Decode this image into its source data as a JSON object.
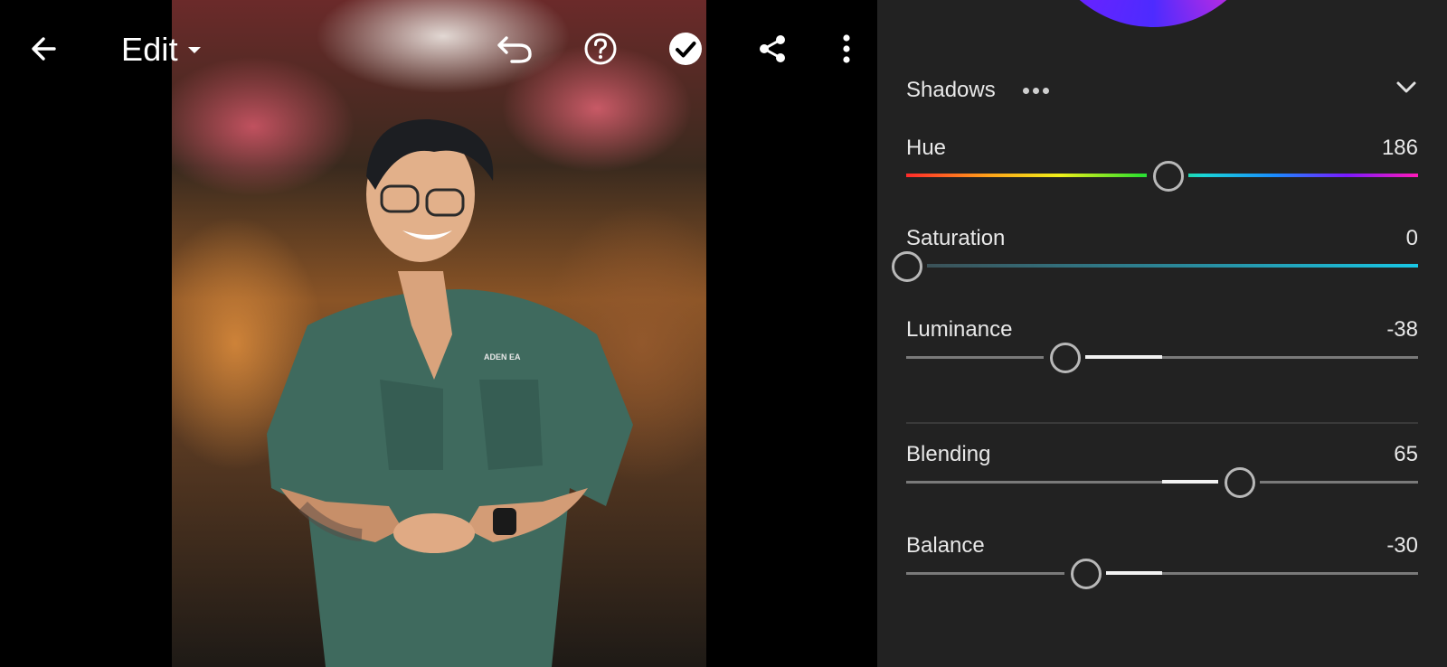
{
  "topbar": {
    "edit_label": "Edit",
    "icons": [
      "back-arrow-icon",
      "dropdown-caret-icon",
      "undo-icon",
      "help-icon",
      "checkmark-icon",
      "share-icon",
      "more-vert-icon"
    ]
  },
  "photo": {
    "shirt_text": "ADEN   EA"
  },
  "panel": {
    "section_title": "Shadows",
    "sliders": {
      "hue": {
        "label": "Hue",
        "value": "186",
        "position": 0.51
      },
      "saturation": {
        "label": "Saturation",
        "value": "0",
        "position": 0.0
      },
      "luminance": {
        "label": "Luminance",
        "value": "-38",
        "position": 0.31
      },
      "blending": {
        "label": "Blending",
        "value": "65",
        "position": 0.65
      },
      "balance": {
        "label": "Balance",
        "value": "-30",
        "position": 0.35
      }
    }
  },
  "colors": {
    "panel_bg": "#222222",
    "track": "#7a7a7a",
    "fill": "#f2f2f2",
    "thumb_border": "#b8b8b8"
  }
}
